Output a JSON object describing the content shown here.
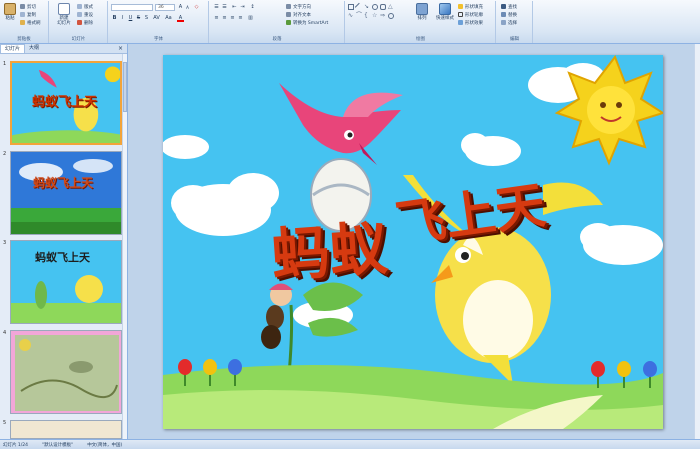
{
  "ribbon": {
    "clipboard": {
      "paste_label": "粘贴",
      "cut_label": "剪切",
      "copy_label": "复制",
      "format_painter_label": "格式刷",
      "group_label": "剪贴板"
    },
    "slides": {
      "new_slide_label": "新建\n幻灯片",
      "layout_label": "版式",
      "reset_label": "重设",
      "delete_label": "删除",
      "group_label": "幻灯片"
    },
    "font": {
      "font_size": "36",
      "group_label": "字体"
    },
    "paragraph": {
      "text_direction_label": "文字方向",
      "align_text_label": "对齐文本",
      "smartart_label": "转换为 SmartArt",
      "group_label": "段落"
    },
    "drawing": {
      "arrange_label": "排列",
      "quick_styles_label": "快速样式",
      "shape_fill_label": "形状填充",
      "shape_outline_label": "形状轮廓",
      "shape_effects_label": "形状效果",
      "group_label": "绘图"
    },
    "editing": {
      "find_label": "查找",
      "replace_label": "替换",
      "select_label": "选择",
      "group_label": "编辑"
    }
  },
  "left_panel": {
    "tabs": [
      "幻灯片",
      "大纲"
    ],
    "close_label": "×",
    "thumbnails": [
      {
        "number": "1",
        "title": "蚂蚁飞上天",
        "selected": true
      },
      {
        "number": "2",
        "title": "蚂蚁飞上天",
        "selected": false
      },
      {
        "number": "3",
        "title": "蚂蚁飞上天",
        "selected": false
      },
      {
        "number": "4",
        "title": "",
        "selected": false
      },
      {
        "number": "5",
        "title": "",
        "selected": false
      }
    ]
  },
  "slide": {
    "title_part1": "蚂蚁",
    "title_part2": "飞上天"
  },
  "status": {
    "slide_info": "幻灯片 1/24",
    "theme": "\"默认设计模板\"",
    "language": "中文(简体，中国)"
  },
  "colors": {
    "sky": "#45c3f1",
    "title_red": "#d63a10",
    "grass": "#8ed85a",
    "selection": "#f3a43a"
  }
}
